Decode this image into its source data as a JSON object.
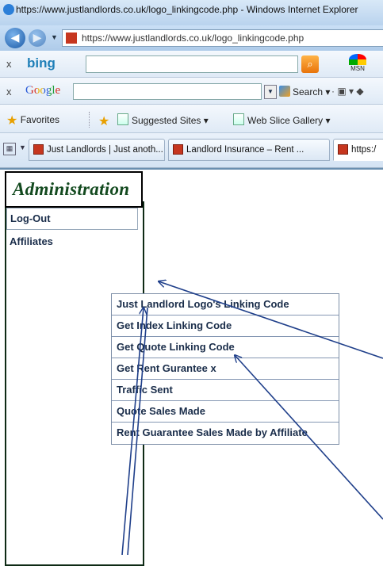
{
  "window": {
    "title": "https://www.justlandlords.co.uk/logo_linkingcode.php - Windows Internet Explorer"
  },
  "address_bar": {
    "url": "https://www.justlandlords.co.uk/logo_linkingcode.php"
  },
  "bing_bar": {
    "close": "x",
    "logo": "bing",
    "msn_label": "MSN"
  },
  "google_bar": {
    "close": "x",
    "logo": "Google",
    "search_label": "Search"
  },
  "favorites_bar": {
    "favorites_label": "Favorites",
    "links": [
      "Suggested Sites ▾",
      "Web Slice Gallery ▾"
    ]
  },
  "tabs": [
    {
      "label": "Just Landlords | Just anoth..."
    },
    {
      "label": "Landlord Insurance – Rent ..."
    },
    {
      "label": "https:/"
    }
  ],
  "sidebar": {
    "title": "Administration",
    "items": [
      {
        "label": "Log-Out"
      },
      {
        "label": "Affiliates"
      }
    ]
  },
  "submenu": {
    "items": [
      {
        "label": "Just Landlord Logo's Linking Code"
      },
      {
        "label": "Get Index Linking Code"
      },
      {
        "label": "Get Quote Linking Code"
      },
      {
        "label": "Get Rent Gurantee x"
      },
      {
        "label": "Traffic Sent"
      },
      {
        "label": "Quote Sales Made"
      },
      {
        "label": "Rent Guarantee Sales Made by Affiliate"
      }
    ]
  },
  "colors": {
    "admin_title": "#134a1f",
    "menu_text": "#1a2d4a",
    "annotation_arrow": "#1f3f8a"
  }
}
